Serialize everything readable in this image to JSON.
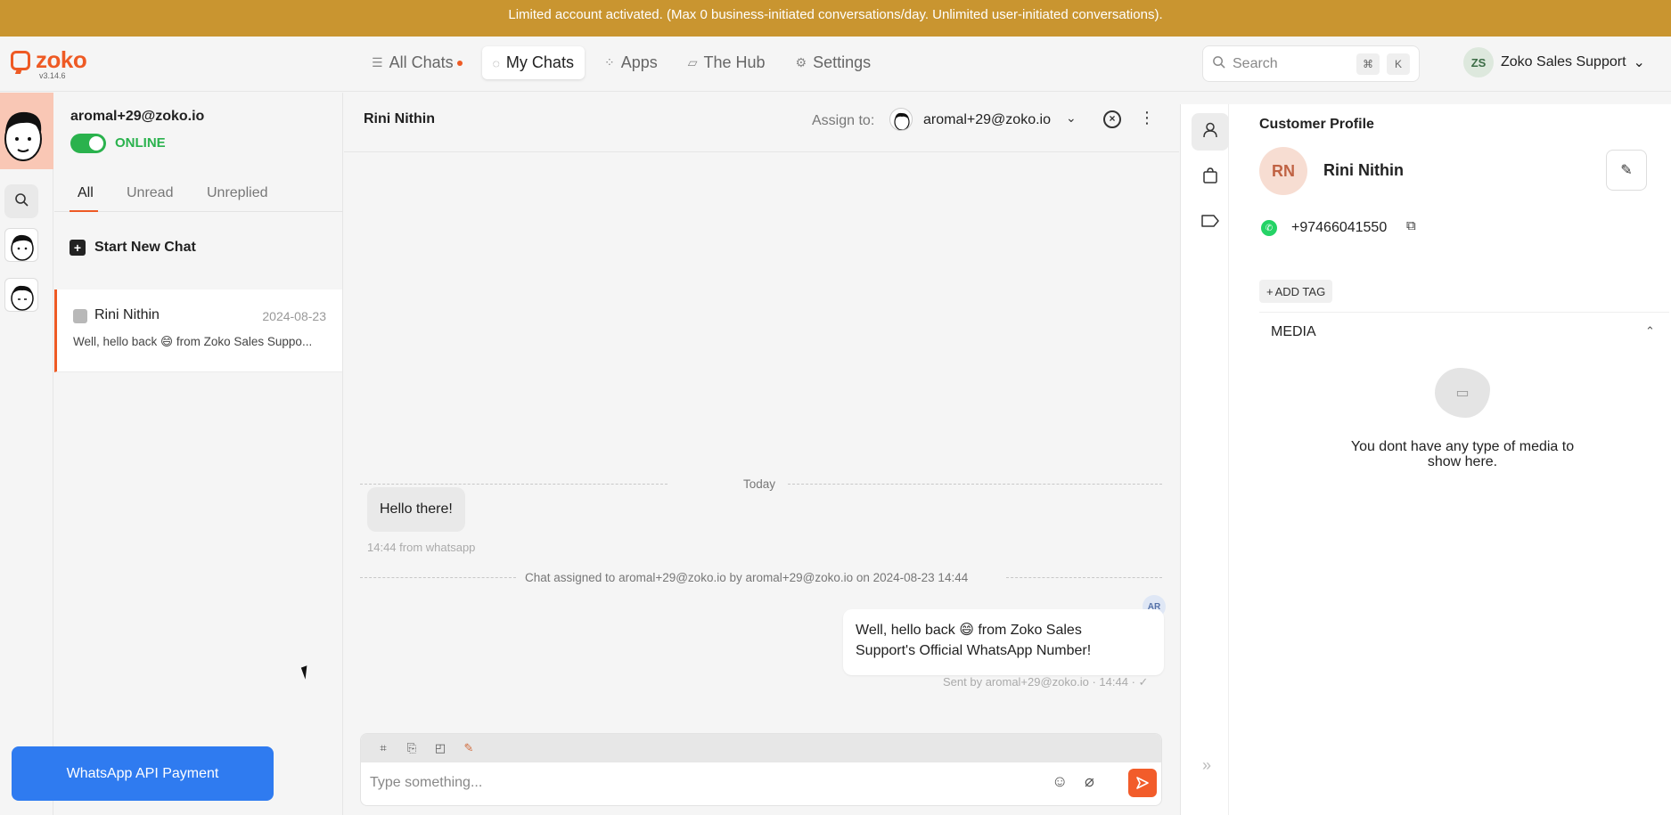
{
  "banner": {
    "text": "Limited account activated. (Max 0 business-initiated conversations/day. Unlimited user-initiated conversations)."
  },
  "brand": {
    "name": "zoko",
    "version": "v3.14.6",
    "accent": "#ee5a24"
  },
  "nav": {
    "items": [
      {
        "label": "All Chats",
        "icon": "list-icon",
        "has_dot": true,
        "active": false
      },
      {
        "label": "My Chats",
        "icon": "chat-bubble-icon",
        "active": true
      },
      {
        "label": "Apps",
        "icon": "grid-icon",
        "active": false
      },
      {
        "label": "The Hub",
        "icon": "chart-icon",
        "active": false
      },
      {
        "label": "Settings",
        "icon": "gear-icon",
        "active": false
      }
    ]
  },
  "search": {
    "placeholder": "Search",
    "shortcut_1": "⌘",
    "shortcut_2": "K"
  },
  "profile": {
    "initials": "ZS",
    "name": "Zoko Sales Support"
  },
  "agent": {
    "email": "aromal+29@zoko.io",
    "status": "ONLINE"
  },
  "tabs": {
    "all": "All",
    "unread": "Unread",
    "unreplied": "Unreplied"
  },
  "list": {
    "new_chat": "Start New Chat",
    "chats": [
      {
        "name": "Rini Nithin",
        "date": "2024-08-23",
        "preview": "Well, hello back 😄 from Zoko Sales Suppo..."
      }
    ]
  },
  "payment_button": "WhatsApp API Payment",
  "chat": {
    "title": "Rini Nithin",
    "assign_label": "Assign to:",
    "assign_value": "aromal+29@zoko.io",
    "day_divider": "Today",
    "incoming_message": "Hello there!",
    "incoming_meta": "14:44 from whatsapp",
    "system_event": "Chat assigned to aromal+29@zoko.io by aromal+29@zoko.io on 2024-08-23 14:44",
    "agent_badge": "AR",
    "outgoing_message_line1": "Well, hello back 😄 from Zoko Sales",
    "outgoing_message_line2": "Support's Official WhatsApp Number!",
    "outgoing_meta": "Sent by aromal+29@zoko.io · 14:44 · ✓",
    "input_placeholder": "Type something..."
  },
  "customer": {
    "section_title": "Customer Profile",
    "initials": "RN",
    "name": "Rini Nithin",
    "phone": "+97466041550",
    "add_tag": "ADD TAG",
    "media_title": "MEDIA",
    "media_empty": "You dont have any type of media to show here."
  }
}
